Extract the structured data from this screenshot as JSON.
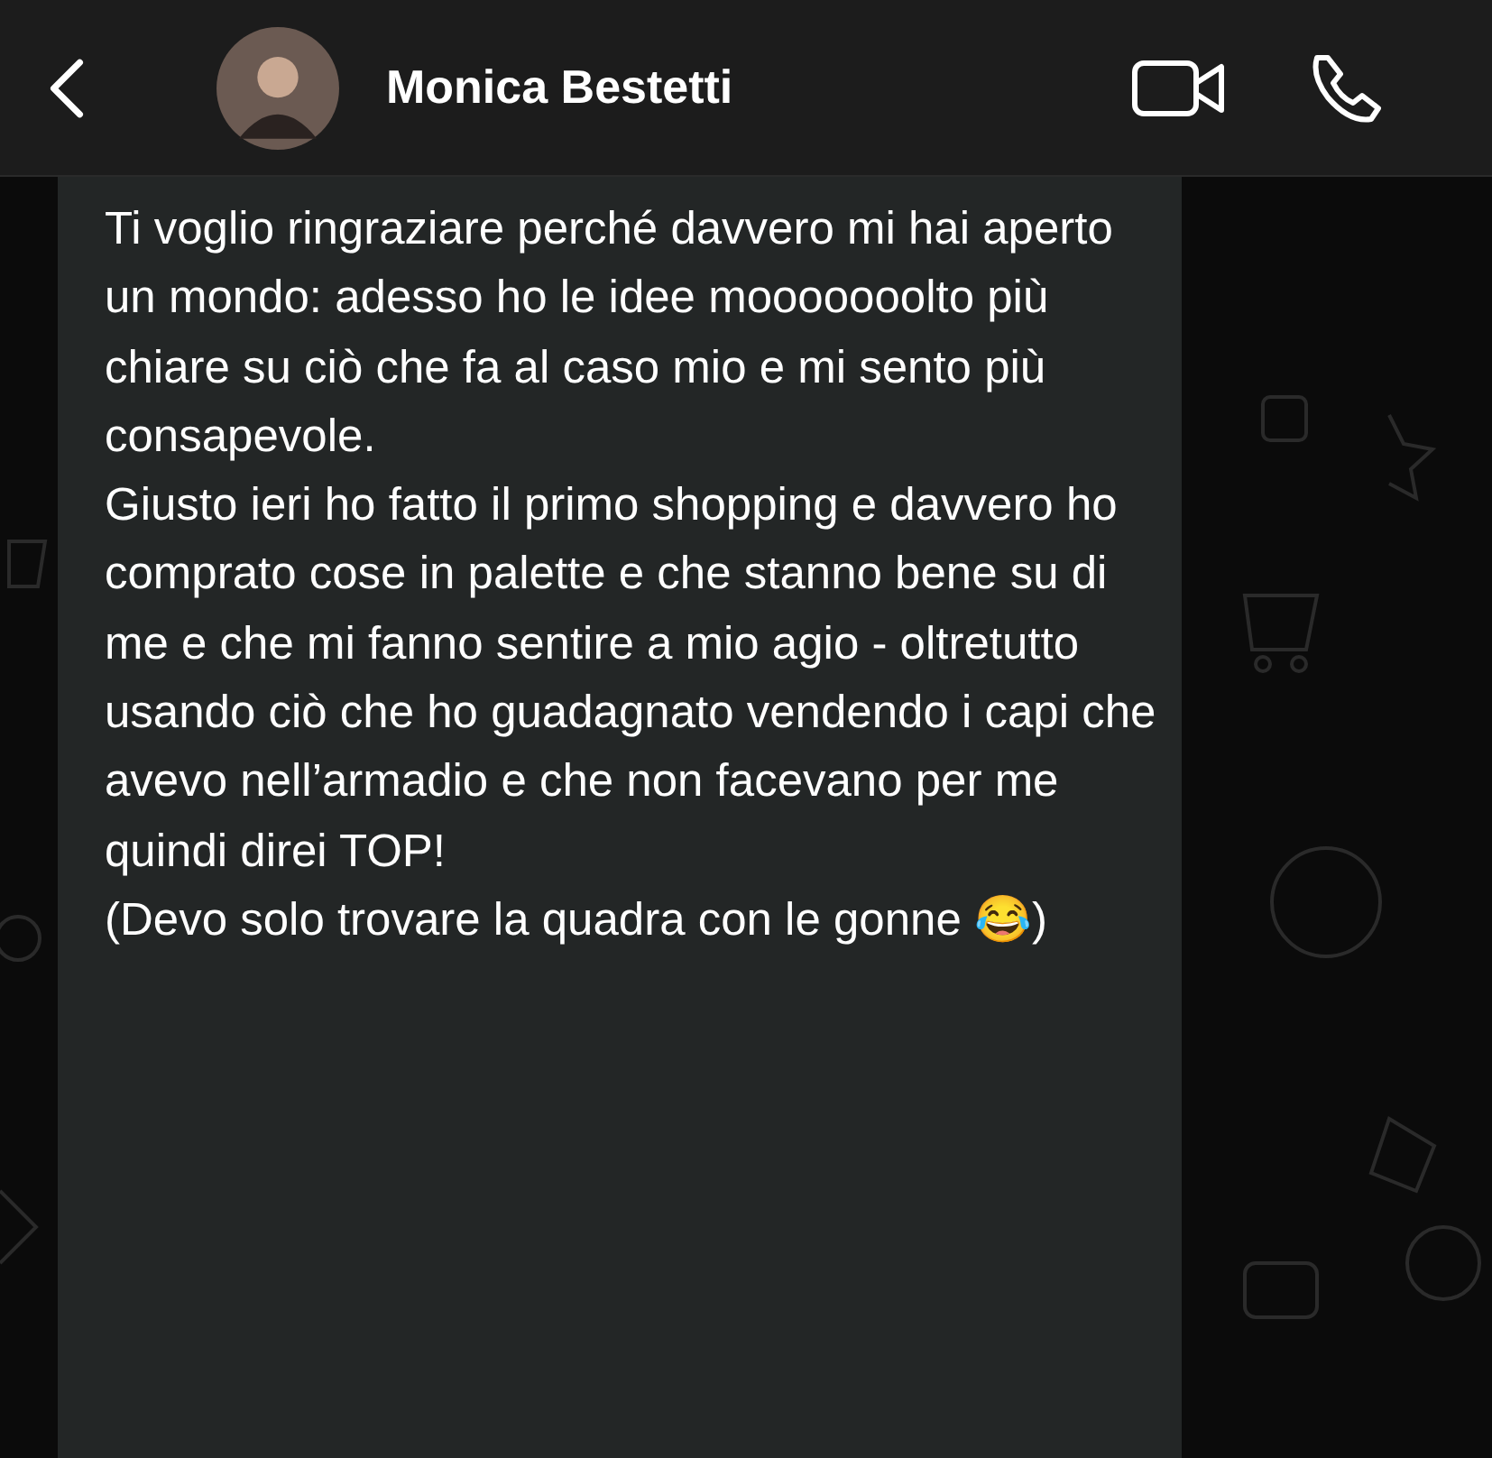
{
  "header": {
    "contact_name": "Monica Bestetti"
  },
  "message": {
    "paragraphs": [
      "Ti voglio ringraziare perché davvero mi hai aperto un mondo: adesso ho le idee mooooooolto più chiare su ciò che fa al caso mio e mi sento più consapevole.",
      "Giusto ieri ho fatto il primo shopping e davvero ho comprato cose in palette e che stanno bene su di me e che mi fanno sentire a mio agio - oltretutto usando ciò che ho guadagnato vendendo i capi che avevo nell’armadio e che non facevano per me quindi direi TOP!",
      "(Devo solo trovare la quadra con le gonne 😂)"
    ]
  }
}
